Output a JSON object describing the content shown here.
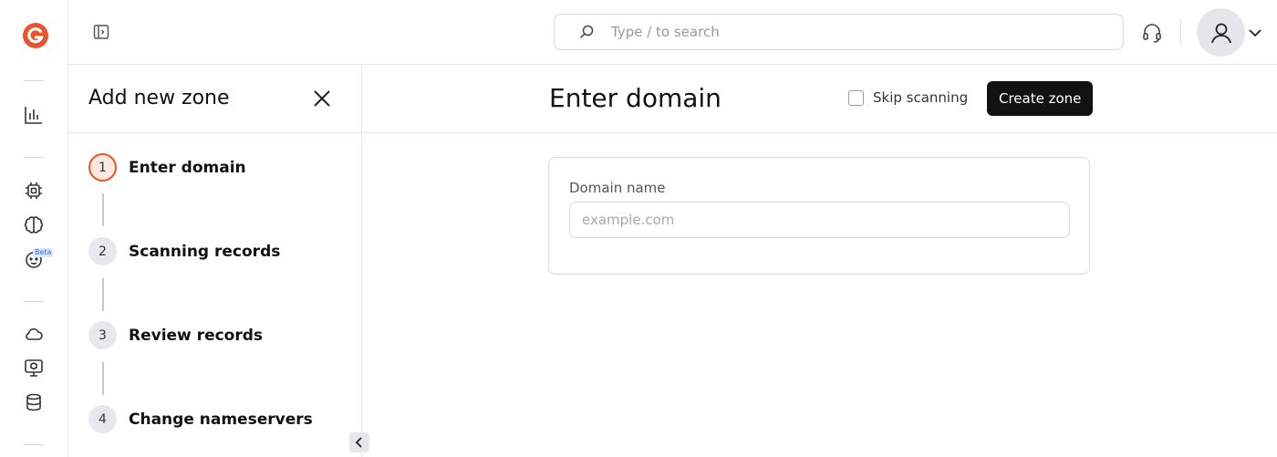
{
  "app": {
    "accent_color": "#e35a28"
  },
  "rail": {
    "items": [
      {
        "name": "analytics-icon"
      },
      {
        "name": "compute-chip-icon"
      },
      {
        "name": "ai-brain-icon"
      },
      {
        "name": "beta-bot-icon",
        "badge": "Beta"
      },
      {
        "name": "cloud-icon"
      },
      {
        "name": "monitor-cube-icon"
      },
      {
        "name": "database-icon"
      }
    ]
  },
  "header": {
    "search_placeholder": "Type / to search"
  },
  "wizard": {
    "title": "Add new zone",
    "steps": [
      {
        "number": "1",
        "label": "Enter domain",
        "active": true
      },
      {
        "number": "2",
        "label": "Scanning records",
        "active": false
      },
      {
        "number": "3",
        "label": "Review records",
        "active": false
      },
      {
        "number": "4",
        "label": "Change nameservers",
        "active": false
      }
    ]
  },
  "main": {
    "title": "Enter domain",
    "skip_label": "Skip scanning",
    "skip_checked": false,
    "create_label": "Create zone",
    "field_label": "Domain name",
    "field_placeholder": "example.com",
    "field_value": ""
  }
}
